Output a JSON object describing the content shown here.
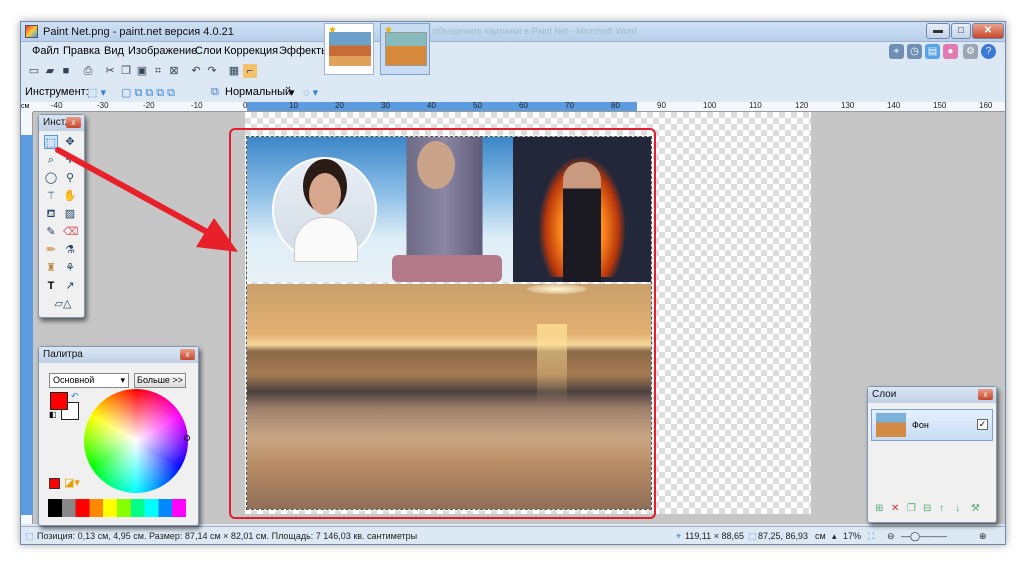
{
  "window": {
    "title": "Paint Net.png - paint.net версия 4.0.21",
    "background_window_text": "Как объединить картинки в Paint.Net - Microsoft Word"
  },
  "menu": [
    "Файл",
    "Правка",
    "Вид",
    "Изображение",
    "Слои",
    "Коррекция",
    "Эффекты"
  ],
  "window_buttons": {
    "minimize": "▬",
    "maximize": "□",
    "close": "✕"
  },
  "toolbar_options": {
    "tool_label": "Инструмент:",
    "blend_mode": "Нормальный"
  },
  "ruler": {
    "unit": "см",
    "marks": [
      "-40",
      "-30",
      "-20",
      "-10",
      "0",
      "10",
      "20",
      "30",
      "40",
      "50",
      "60",
      "70",
      "80",
      "90",
      "100",
      "110",
      "120",
      "130",
      "140",
      "150",
      "160"
    ]
  },
  "tools_panel": {
    "title": "Инст...",
    "close": "x"
  },
  "palette_panel": {
    "title": "Палитра",
    "mode": "Основной",
    "more_button": "Больше >>",
    "primary_color": "#ff0000",
    "secondary_color": "#ffffff"
  },
  "layers_panel": {
    "title": "Слои",
    "layer_name": "Фон",
    "checked": "✓"
  },
  "status": {
    "position": "Позиция: 0,13 см, 4,95 см. Размер: 87,14 см × 82,01 см. Площадь: 7 146,03 кв. сантиметры",
    "cursor": "119,11 × 88,65",
    "selection": "87,25, 86,93",
    "unit": "см",
    "zoom": "17%"
  },
  "icons": {
    "arrow_color": "#e8202a",
    "highlight_color": "#e0202c"
  }
}
